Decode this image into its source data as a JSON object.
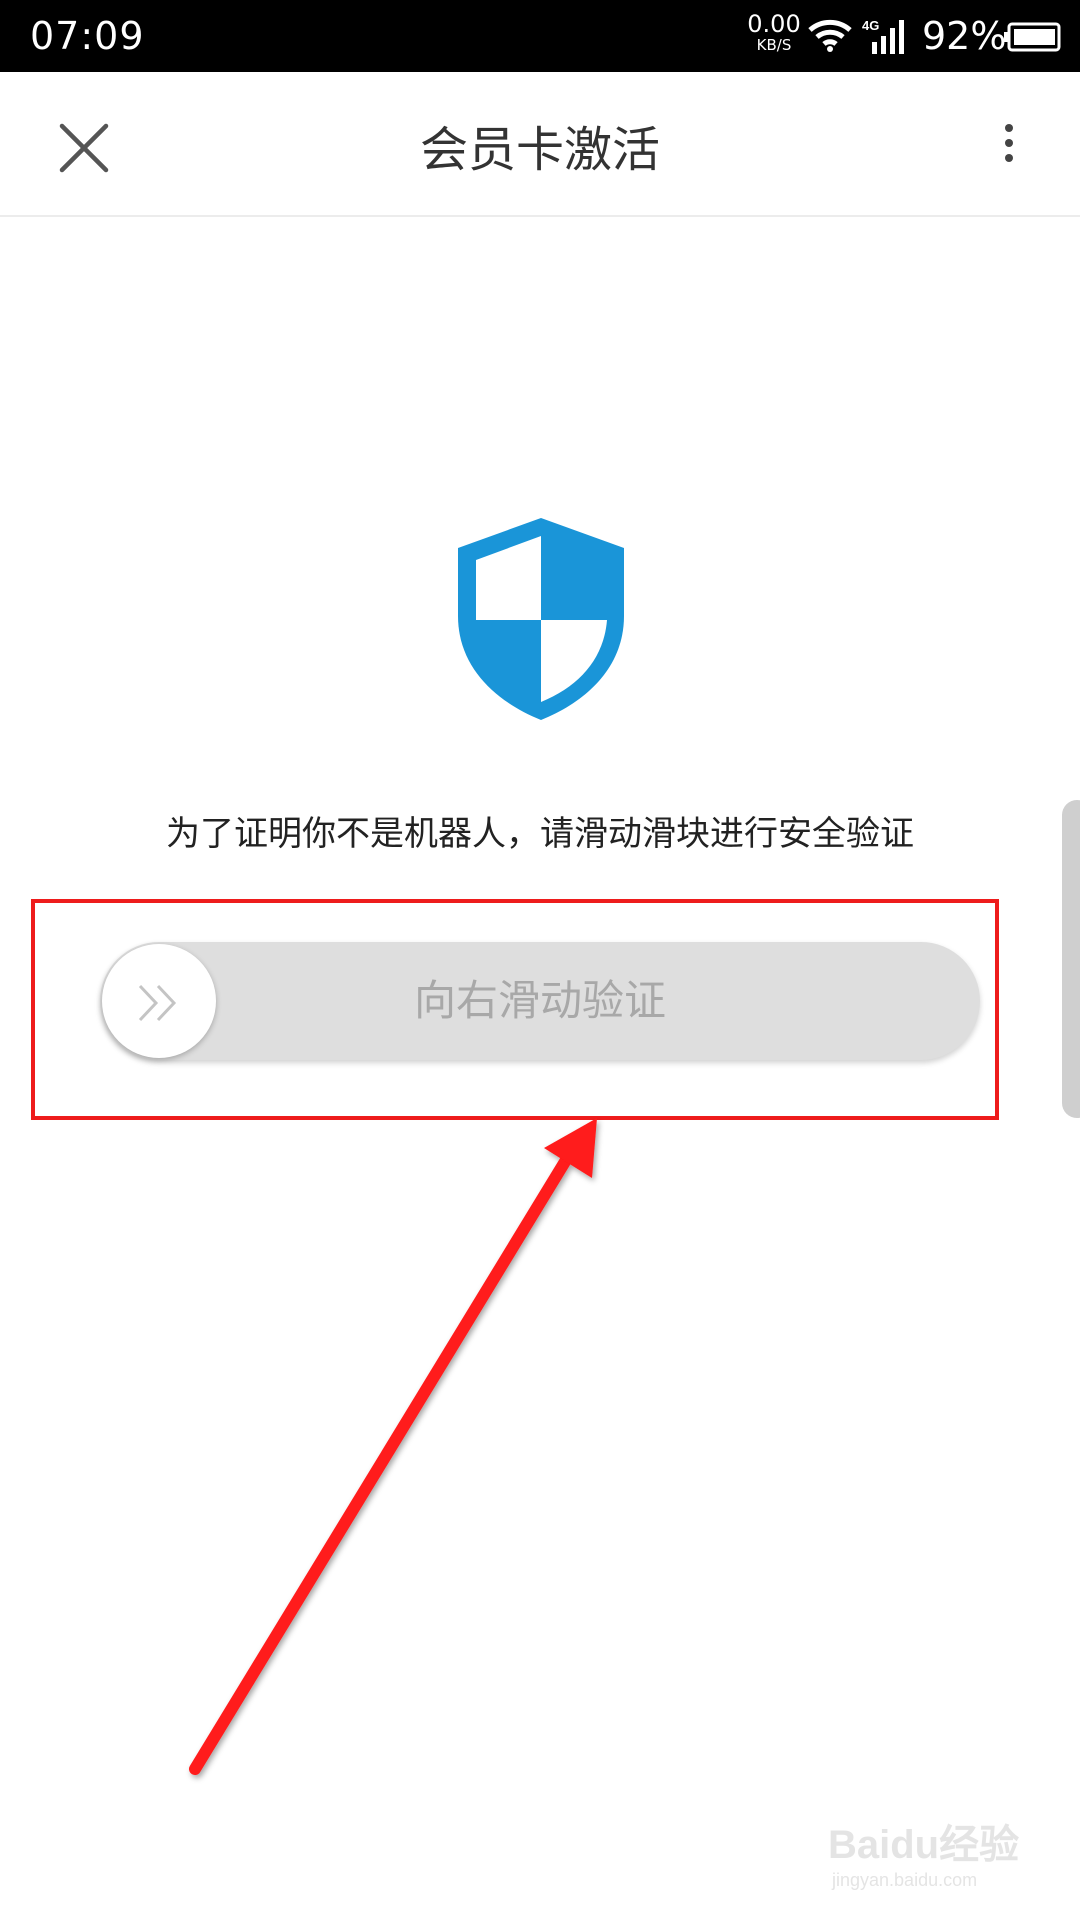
{
  "status_bar": {
    "time": "07:09",
    "net_rate": "0.00",
    "net_unit": "KB/S",
    "network_type": "4G",
    "battery": "92%"
  },
  "header": {
    "title": "会员卡激活"
  },
  "content": {
    "instruction": "为了证明你不是机器人，请滑动滑块进行安全验证",
    "slider_label": "向右滑动验证"
  },
  "watermark": {
    "logo": "Baidu经验",
    "url": "jingyan.baidu.com"
  },
  "colors": {
    "shield": "#1a95d8",
    "highlight": "#ee1c1c",
    "arrow": "#ff1a1a"
  },
  "icons": [
    "close-icon",
    "more-icon",
    "shield-icon",
    "double-chevron-right-icon",
    "wifi-icon",
    "signal-icon",
    "battery-icon"
  ]
}
